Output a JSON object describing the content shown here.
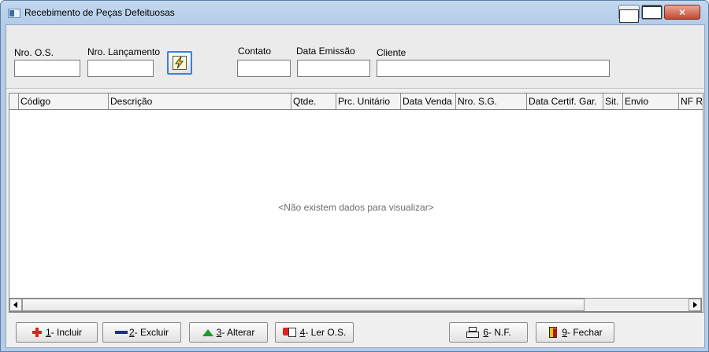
{
  "window": {
    "title": "Recebimento de Peças Defeituosas",
    "close_glyph": "✕"
  },
  "filters": {
    "nro_os_label": "Nro. O.S.",
    "nro_lancamento_label": "Nro. Lançamento",
    "contato_label": "Contato",
    "data_emissao_label": "Data Emissão",
    "cliente_label": "Cliente",
    "nro_os_value": "",
    "nro_lancamento_value": "",
    "contato_value": "",
    "data_emissao_value": "",
    "cliente_value": "",
    "search_glyph": "⚡"
  },
  "grid": {
    "columns": [
      "Código",
      "Descrição",
      "Qtde.",
      "Prc. Unitário",
      "Data Venda",
      "Nro. S.G.",
      "Data Certif. Gar.",
      "Sit.",
      "Envio",
      "NF R"
    ],
    "empty_message": "<Não existem dados para visualizar>"
  },
  "buttons": {
    "incluir": {
      "key": "1",
      "label": "- Incluir"
    },
    "excluir": {
      "key": "2",
      "label": "- Excluir"
    },
    "alterar": {
      "key": "3",
      "label": "- Alterar"
    },
    "ler_os": {
      "key": "4",
      "label": "- Ler O.S."
    },
    "nf": {
      "key": "6",
      "label": "- N.F."
    },
    "fechar": {
      "key": "9",
      "label": "- Fechar"
    }
  },
  "colors": {
    "title_bar": "#b9d1ea",
    "close_button": "#c24730",
    "focus_border": "#3c7fd6"
  }
}
